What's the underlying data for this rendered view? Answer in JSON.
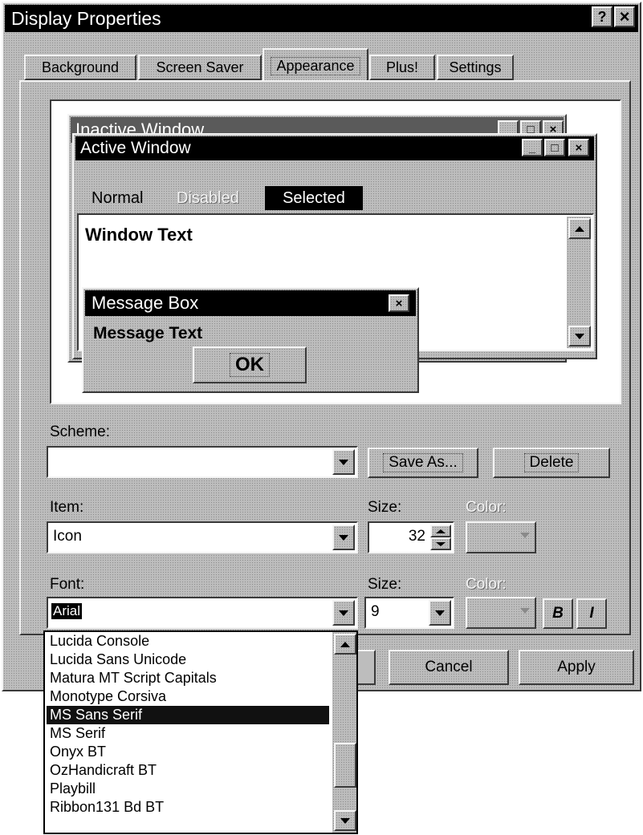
{
  "window": {
    "title": "Display Properties",
    "help_btn": "?",
    "close_btn": "×"
  },
  "tabs": [
    "Background",
    "Screen Saver",
    "Appearance",
    "Plus!",
    "Settings"
  ],
  "preview": {
    "inactive_title": "Inactive Window",
    "active_title": "Active Window",
    "menu": {
      "normal": "Normal",
      "disabled": "Disabled",
      "selected": "Selected"
    },
    "window_text": "Window Text",
    "message_title": "Message Box",
    "message_text": "Message Text",
    "ok_label": "OK"
  },
  "scheme": {
    "label": "Scheme:",
    "value": "",
    "save_as": "Save As...",
    "delete": "Delete"
  },
  "item": {
    "label": "Item:",
    "value": "Icon",
    "size_label": "Size:",
    "size_value": "32",
    "color_label": "Color:"
  },
  "font": {
    "label": "Font:",
    "value": "Arial",
    "size_label": "Size:",
    "size_value": "9",
    "color_label": "Color:",
    "bold": "B",
    "italic": "I"
  },
  "font_list": {
    "items": [
      "Lucida Console",
      "Lucida Sans Unicode",
      "Matura MT Script Capitals",
      "Monotype Corsiva",
      "MS Sans Serif",
      "MS Serif",
      "Onyx BT",
      "OzHandicraft BT",
      "Playbill",
      "Ribbon131 Bd BT"
    ],
    "selected_index": 4
  },
  "buttons": {
    "cancel": "Cancel",
    "apply": "Apply"
  },
  "colors": {
    "title_bg": "#000000",
    "selected_bg": "#111111",
    "window_bg": "#bdbdbd"
  }
}
